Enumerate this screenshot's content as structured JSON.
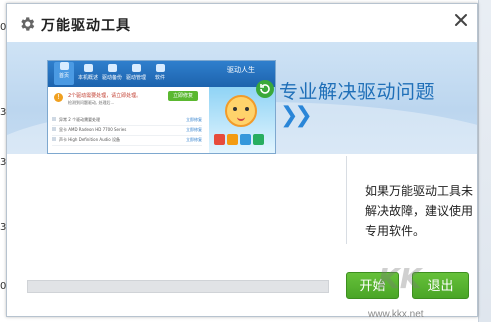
{
  "background": {
    "left_fragments": [
      "01",
      "3",
      "3",
      "3",
      "0"
    ]
  },
  "dialog": {
    "title": "万能驱动工具",
    "icons": {
      "app": "gear-icon",
      "close": "close-icon"
    },
    "banner": {
      "headline": "专业解决驱动问题",
      "chevrons": "❯❯",
      "preview": {
        "nav": [
          "首页",
          "本机概述",
          "驱动备份",
          "驱动管理",
          "软件"
        ],
        "brand": "驱动人生",
        "alert_count": "!",
        "alert_text": "2个驱动需要处理，请立即处理。",
        "alert_sub": "检测到问题驱动, 处理后...",
        "fix_button": "立即修复",
        "rows": [
          {
            "label": "异常 2 个驱动需要处理",
            "action": "立即修复"
          },
          {
            "label": "显卡       AMD Radeon HD 7700 Series",
            "action": "立即修复"
          },
          {
            "label": "声卡       High Definition Audio 设备",
            "action": "立即修复"
          }
        ],
        "apps_colors": [
          "#e74c3c",
          "#f39c12",
          "#3498db",
          "#27ae60",
          "#9b59b6",
          "#16a085",
          "#e67e22",
          "#2980b9",
          "#c0392b",
          "#8e44ad"
        ]
      }
    },
    "description": "如果万能驱动工具未解决故障，建议使用专用软件。",
    "progress": {
      "value": 0
    },
    "buttons": {
      "start": "开始",
      "exit": "退出"
    }
  },
  "watermark": {
    "text": "KK",
    "url": "www.kkx.net"
  },
  "colors": {
    "accent_blue": "#1f6fb8",
    "button_green": "#4aa527"
  }
}
